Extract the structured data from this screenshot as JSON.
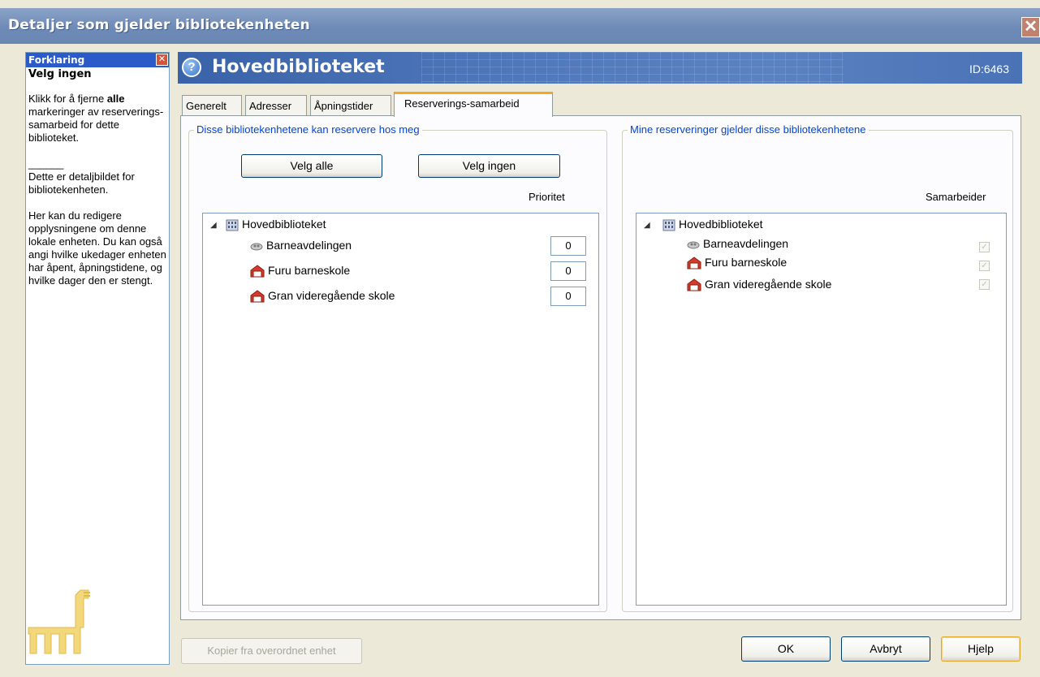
{
  "window": {
    "title": "Detaljer som gjelder bibliotekenheten",
    "close_label": "✕"
  },
  "help": {
    "header": "Forklaring",
    "subtitle": "Velg ingen",
    "p1_pre": "Klikk for å fjerne ",
    "p1_bold": "alle",
    "p1_post": " markeringer av reserverings-samarbeid for dette biblioteket.",
    "separator": "______",
    "p2": "Dette er detaljbildet for bibliotekenheten.",
    "p3": "Her kan du redigere opplysningene om denne lokale enheten. Du kan også angi hvilke ukedager enheten har åpent, åpningstidene, og hvilke dager den er stengt."
  },
  "header": {
    "title": "Hovedbiblioteket",
    "id": "ID:6463"
  },
  "tabs": [
    {
      "label": "Generelt",
      "active": false
    },
    {
      "label": "Adresser",
      "active": false
    },
    {
      "label": "Åpningstider",
      "active": false
    },
    {
      "label": "Reserverings-samarbeid",
      "active": true
    }
  ],
  "left": {
    "legend": "Disse bibliotekenhetene kan reservere hos meg",
    "select_all": "Velg alle",
    "select_none": "Velg ingen",
    "column": "Prioritet",
    "root": "Hovedbiblioteket",
    "items": [
      {
        "label": "Barneavdelingen",
        "priority": "0",
        "icon": "branch-icon"
      },
      {
        "label": "Furu barneskole",
        "priority": "0",
        "icon": "school-house-icon"
      },
      {
        "label": "Gran videregående skole",
        "priority": "0",
        "icon": "school-house-icon"
      }
    ]
  },
  "right": {
    "legend": "Mine reserveringer gjelder disse bibliotekenhetene",
    "column": "Samarbeider",
    "root": "Hovedbiblioteket",
    "items": [
      {
        "label": "Barneavdelingen",
        "checked": true
      },
      {
        "label": "Furu barneskole",
        "checked": true
      },
      {
        "label": "Gran videregående skole",
        "checked": true
      }
    ]
  },
  "footer": {
    "copy": "Kopier fra overordnet enhet",
    "ok": "OK",
    "cancel": "Avbryt",
    "help": "Hjelp"
  },
  "colors": {
    "accent_tab": "#f5a623",
    "title_band": "#4f78bb",
    "legend_text": "#0046d5"
  }
}
